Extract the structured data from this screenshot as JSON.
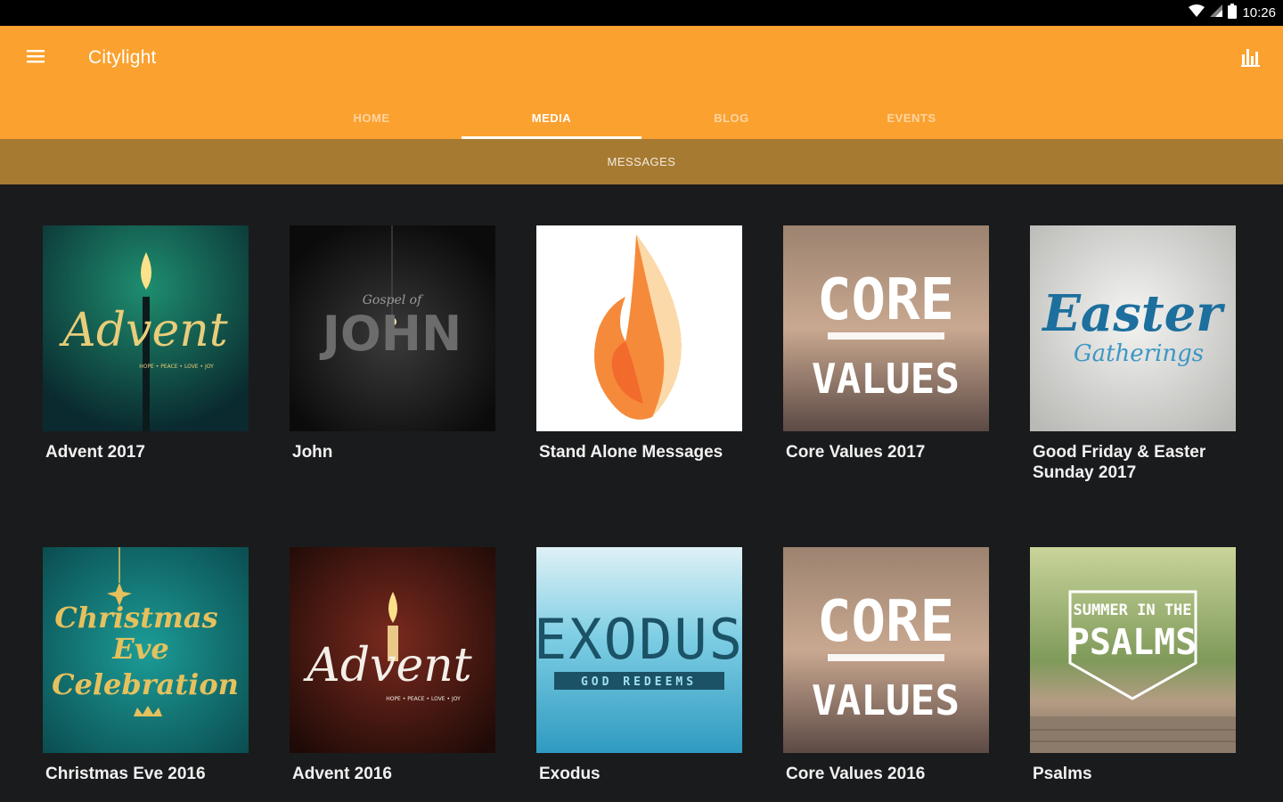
{
  "status_bar": {
    "time": "10:26"
  },
  "app_bar": {
    "title": "Citylight",
    "menu_icon": "hamburger-icon",
    "action_icon": "bar-chart-icon"
  },
  "tabs": [
    {
      "label": "HOME"
    },
    {
      "label": "MEDIA"
    },
    {
      "label": "BLOG"
    },
    {
      "label": "EVENTS"
    }
  ],
  "active_tab": "MEDIA",
  "sub_bar": {
    "label": "MESSAGES"
  },
  "series": [
    {
      "title": "Advent 2017",
      "art_text": "Advent",
      "art_caption": "HOPE • PEACE • LOVE • JOY"
    },
    {
      "title": "John",
      "art_text": "JOHN",
      "art_caption": "Gospel of"
    },
    {
      "title": "Stand Alone Messages"
    },
    {
      "title": "Core Values 2017",
      "art_text": "CORE",
      "art_text2": "VALUES"
    },
    {
      "title": "Good Friday & Easter Sunday 2017",
      "art_text": "Easter",
      "art_text2": "Gatherings"
    },
    {
      "title": "Christmas Eve 2016",
      "art_text": "Christmas",
      "art_text2": "Eve",
      "art_text3": "Celebration"
    },
    {
      "title": "Advent 2016",
      "art_text": "Advent",
      "art_caption": "HOPE • PEACE • LOVE • JOY"
    },
    {
      "title": "Exodus",
      "art_text": "EXODUS",
      "art_caption": "GOD REDEEMS"
    },
    {
      "title": "Core Values 2016",
      "art_text": "CORE",
      "art_text2": "VALUES"
    },
    {
      "title": "Psalms",
      "art_text": "SUMMER IN THE",
      "art_text2": "PSALMS"
    }
  ],
  "colors": {
    "accent": "#fba12f",
    "sub_bar": "#a77a32",
    "background": "#1a1b1d",
    "status_bar": "#000000"
  }
}
